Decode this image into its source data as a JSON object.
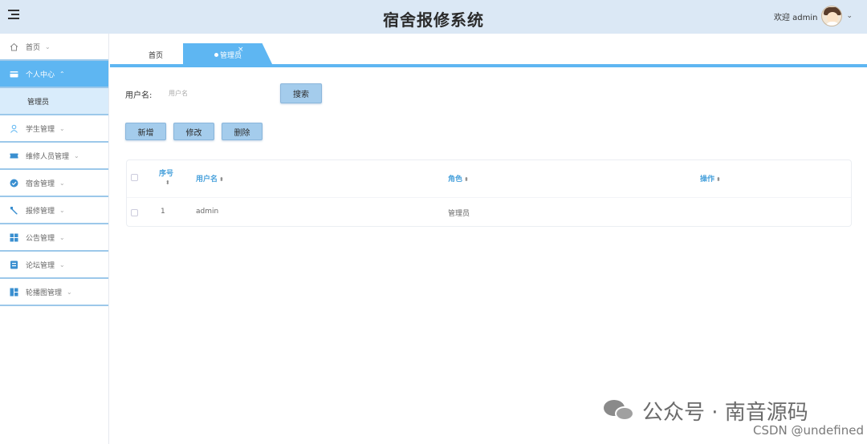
{
  "header": {
    "title": "宿舍报修系统",
    "welcome": "欢迎 admin"
  },
  "sidebar": {
    "items": [
      {
        "label": "首页",
        "icon": "home-icon"
      },
      {
        "label": "个人中心",
        "icon": "wallet-icon",
        "active": true
      },
      {
        "label": "学生管理",
        "icon": "user-icon"
      },
      {
        "label": "维修人员管理",
        "icon": "ticket-icon"
      },
      {
        "label": "宿舍管理",
        "icon": "check-circle-icon"
      },
      {
        "label": "报修管理",
        "icon": "tool-icon"
      },
      {
        "label": "公告管理",
        "icon": "grid-icon"
      },
      {
        "label": "论坛管理",
        "icon": "forum-icon"
      },
      {
        "label": "轮播图管理",
        "icon": "carousel-icon"
      }
    ],
    "sub_item": "管理员"
  },
  "tabs": {
    "home": "首页",
    "active": "管理员",
    "close": "×"
  },
  "search": {
    "label": "用户名:",
    "placeholder": "用户名",
    "button": "搜索"
  },
  "actions": {
    "add": "新增",
    "edit": "修改",
    "delete": "删除"
  },
  "table": {
    "headers": {
      "index": "序号",
      "username": "用户名",
      "role": "角色",
      "operation": "操作"
    },
    "rows": [
      {
        "index": "1",
        "username": "admin",
        "role": "管理员"
      }
    ]
  },
  "watermark": {
    "text": "公众号 · 南音源码",
    "csdn": "CSDN @undefined"
  },
  "colors": {
    "accent": "#5eb6f2",
    "header_bg": "#dbe8f5",
    "button_bg": "#a4ccec"
  }
}
